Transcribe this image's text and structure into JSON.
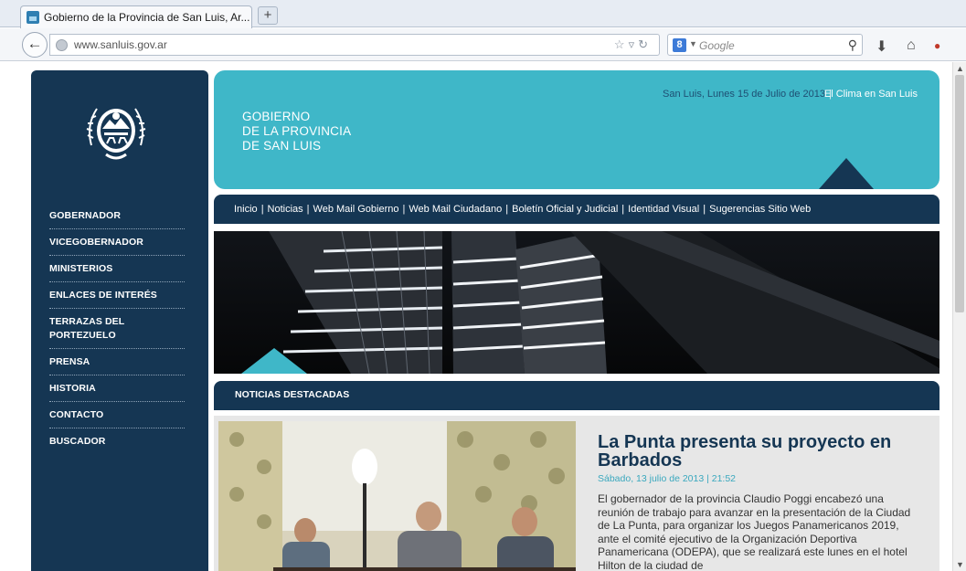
{
  "browser": {
    "tab_title": "Gobierno de la Provincia de San Luis, Ar...",
    "new_tab_label": "+",
    "url": "www.sanluis.gov.ar",
    "search_engine_letter": "8",
    "search_placeholder": "Google"
  },
  "header": {
    "brand_line1": "GOBIERNO",
    "brand_line2": "DE LA PROVINCIA",
    "brand_line3": "DE SAN LUIS",
    "date_text": "San Luis, Lunes 15 de Julio de 2013",
    "separator": "|",
    "weather_link": "El Clima en San Luis"
  },
  "sidebar": {
    "items": [
      {
        "label": "GOBERNADOR"
      },
      {
        "label": "VICEGOBERNADOR"
      },
      {
        "label": "MINISTERIOS"
      },
      {
        "label": "ENLACES DE INTERÉS"
      },
      {
        "label": "TERRAZAS DEL PORTEZUELO"
      },
      {
        "label": "PRENSA"
      },
      {
        "label": "HISTORIA"
      },
      {
        "label": "CONTACTO"
      },
      {
        "label": "BUSCADOR"
      }
    ]
  },
  "topnav": {
    "separator": "|",
    "links": [
      {
        "label": "Inicio"
      },
      {
        "label": "Noticias"
      },
      {
        "label": "Web Mail Gobierno"
      },
      {
        "label": "Web Mail Ciudadano"
      },
      {
        "label": "Boletín Oficial y Judicial"
      },
      {
        "label": "Identidad Visual"
      },
      {
        "label": "Sugerencias Sitio Web"
      }
    ]
  },
  "section": {
    "title": "NOTICIAS DESTACADAS"
  },
  "news": {
    "title": "La Punta presenta su proyecto en Barbados",
    "date": "Sábado, 13 julio de 2013 | 21:52",
    "body": "El gobernador de la provincia Claudio Poggi encabezó una reunión de trabajo para avanzar en la presentación de la Ciudad de La Punta, para organizar los Juegos Panamericanos 2019, ante el comité ejecutivo de la Organización Deportiva Panamericana (ODEPA), que se realizará este lunes en el hotel Hilton de la ciudad de"
  },
  "colors": {
    "navy": "#153653",
    "teal": "#3fb7c8",
    "news_date": "#3aa8be"
  },
  "icons": [
    "back-arrow-icon",
    "globe-icon",
    "star-icon",
    "reload-icon",
    "search-icon",
    "download-icon",
    "home-icon",
    "addon-icon",
    "seal-icon",
    "page-scroll-up-icon",
    "page-scroll-down-icon"
  ]
}
